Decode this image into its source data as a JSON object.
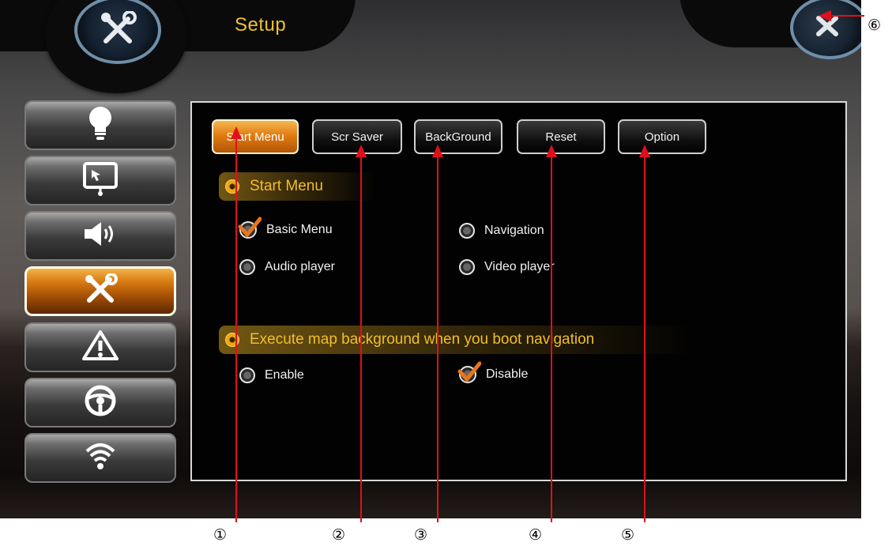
{
  "header": {
    "title": "Setup",
    "main_icon": "tools-icon",
    "close_icon": "close-icon"
  },
  "sidebar": {
    "items": [
      {
        "name": "sidebar-item-light",
        "icon": "lightbulb-icon"
      },
      {
        "name": "sidebar-item-display",
        "icon": "display-icon"
      },
      {
        "name": "sidebar-item-sound",
        "icon": "speaker-icon"
      },
      {
        "name": "sidebar-item-setup",
        "icon": "tools-icon",
        "active": true
      },
      {
        "name": "sidebar-item-warning",
        "icon": "warning-icon"
      },
      {
        "name": "sidebar-item-steering",
        "icon": "steering-wheel-icon"
      },
      {
        "name": "sidebar-item-wireless",
        "icon": "wifi-icon"
      }
    ]
  },
  "tabs": [
    {
      "label": "Start Menu",
      "active": true
    },
    {
      "label": "Scr Saver"
    },
    {
      "label": "BackGround"
    },
    {
      "label": "Reset"
    },
    {
      "label": "Option"
    }
  ],
  "start_menu": {
    "heading": "Start Menu",
    "options": [
      {
        "label": "Basic Menu",
        "selected": true
      },
      {
        "label": "Navigation",
        "selected": false
      },
      {
        "label": "Audio player",
        "selected": false
      },
      {
        "label": "Video player",
        "selected": false
      }
    ]
  },
  "map_background": {
    "heading": "Execute map background when you boot navigation",
    "options": [
      {
        "label": "Enable",
        "selected": false
      },
      {
        "label": "Disable",
        "selected": true
      }
    ]
  },
  "annotations": [
    "①",
    "②",
    "③",
    "④",
    "⑤",
    "⑥"
  ],
  "colors": {
    "accent_orange": "#e07d12",
    "title_yellow": "#f0c22a",
    "annotation_red": "#e0101a"
  }
}
